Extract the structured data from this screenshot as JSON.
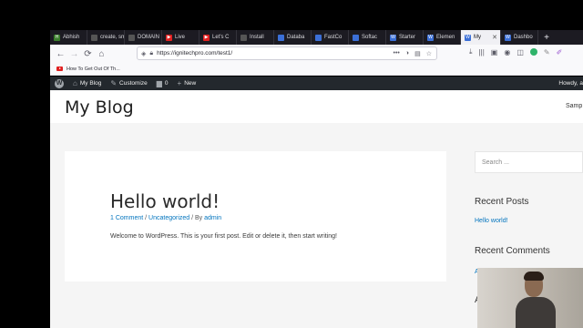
{
  "browser": {
    "tabs": [
      {
        "label": "Abhish",
        "fav_icon": "hostinger-icon",
        "fav_color": "#3a7d2c"
      },
      {
        "label": "create, sme",
        "fav_icon": "page-icon",
        "fav_color": "#555555"
      },
      {
        "label": "DOMAIN N",
        "fav_icon": "page-icon",
        "fav_color": "#555555"
      },
      {
        "label": "Live",
        "fav_icon": "youtube-icon",
        "fav_color": "#e02020"
      },
      {
        "label": "Let's C",
        "fav_icon": "youtube-icon",
        "fav_color": "#e02020"
      },
      {
        "label": "Install",
        "fav_icon": "page-icon",
        "fav_color": "#555555"
      },
      {
        "label": "Databa",
        "fav_icon": "page-icon",
        "fav_color": "#3b6fd6"
      },
      {
        "label": "FastCo",
        "fav_icon": "page-icon",
        "fav_color": "#3b6fd6"
      },
      {
        "label": "Softac",
        "fav_icon": "page-icon",
        "fav_color": "#3b6fd6"
      },
      {
        "label": "Starter",
        "fav_icon": "wordpress-icon",
        "fav_color": "#3b6fd6"
      },
      {
        "label": "Elemen",
        "fav_icon": "wordpress-icon",
        "fav_color": "#3b6fd6"
      },
      {
        "label": "My",
        "fav_icon": "wordpress-icon",
        "fav_color": "#3b6fd6",
        "active": true
      },
      {
        "label": "Dashbo",
        "fav_icon": "wordpress-icon",
        "fav_color": "#3b6fd6"
      }
    ],
    "new_tab_label": "+",
    "url": "https://ignitechpro.com/test1/",
    "bookmark_label": "How To Get Out Of Th..."
  },
  "adminbar": {
    "my_blog": "My Blog",
    "customize": "Customize",
    "comments_count": "0",
    "new_label": "New",
    "howdy": "Howdy, a"
  },
  "site": {
    "title": "My Blog",
    "nav_item": "Samp"
  },
  "post": {
    "title": "Hello world!",
    "comments_link": "1 Comment",
    "meta_sep1": " / ",
    "category": "Uncategorized",
    "meta_sep2": " / By ",
    "author": "admin",
    "body": "Welcome to WordPress. This is your first post. Edit or delete it, then start writing!"
  },
  "sidebar": {
    "search_placeholder": "Search ...",
    "recent_posts_title": "Recent Posts",
    "recent_post_link": "Hello world!",
    "recent_comments_title": "Recent Comments",
    "recent_comments_frag": "A",
    "archives_frag": "A"
  },
  "colors": {
    "link": "#0274be",
    "adminbar": "#23282d",
    "tabstrip": "#1c1b22"
  }
}
